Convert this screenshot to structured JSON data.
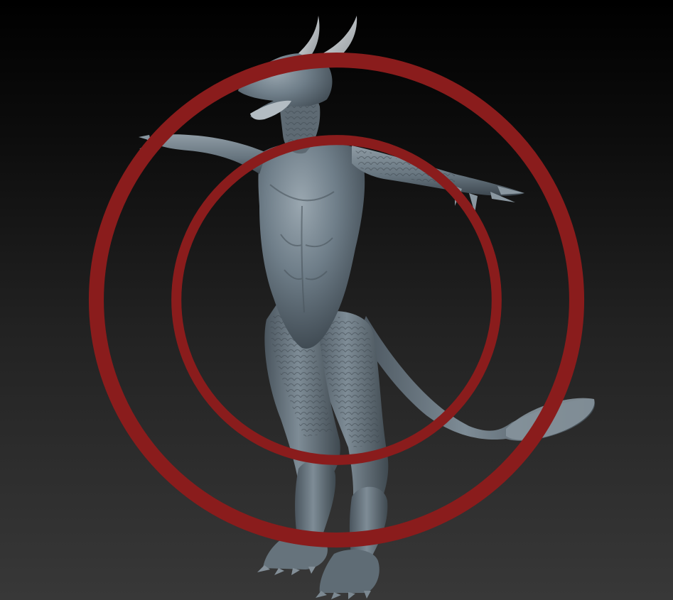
{
  "viewport": {
    "background_top": "#000000",
    "background_bottom": "#383838"
  },
  "model": {
    "subject": "dragon-humanoid-sculpt",
    "material_color": "#6f7e89",
    "highlight_color": "#9aa7b0",
    "shadow_color": "#3a444c",
    "horn_color": "#c9cdd0"
  },
  "gizmo": {
    "icon": "axis-gizmo-icon",
    "color": "#8a1c1c"
  }
}
